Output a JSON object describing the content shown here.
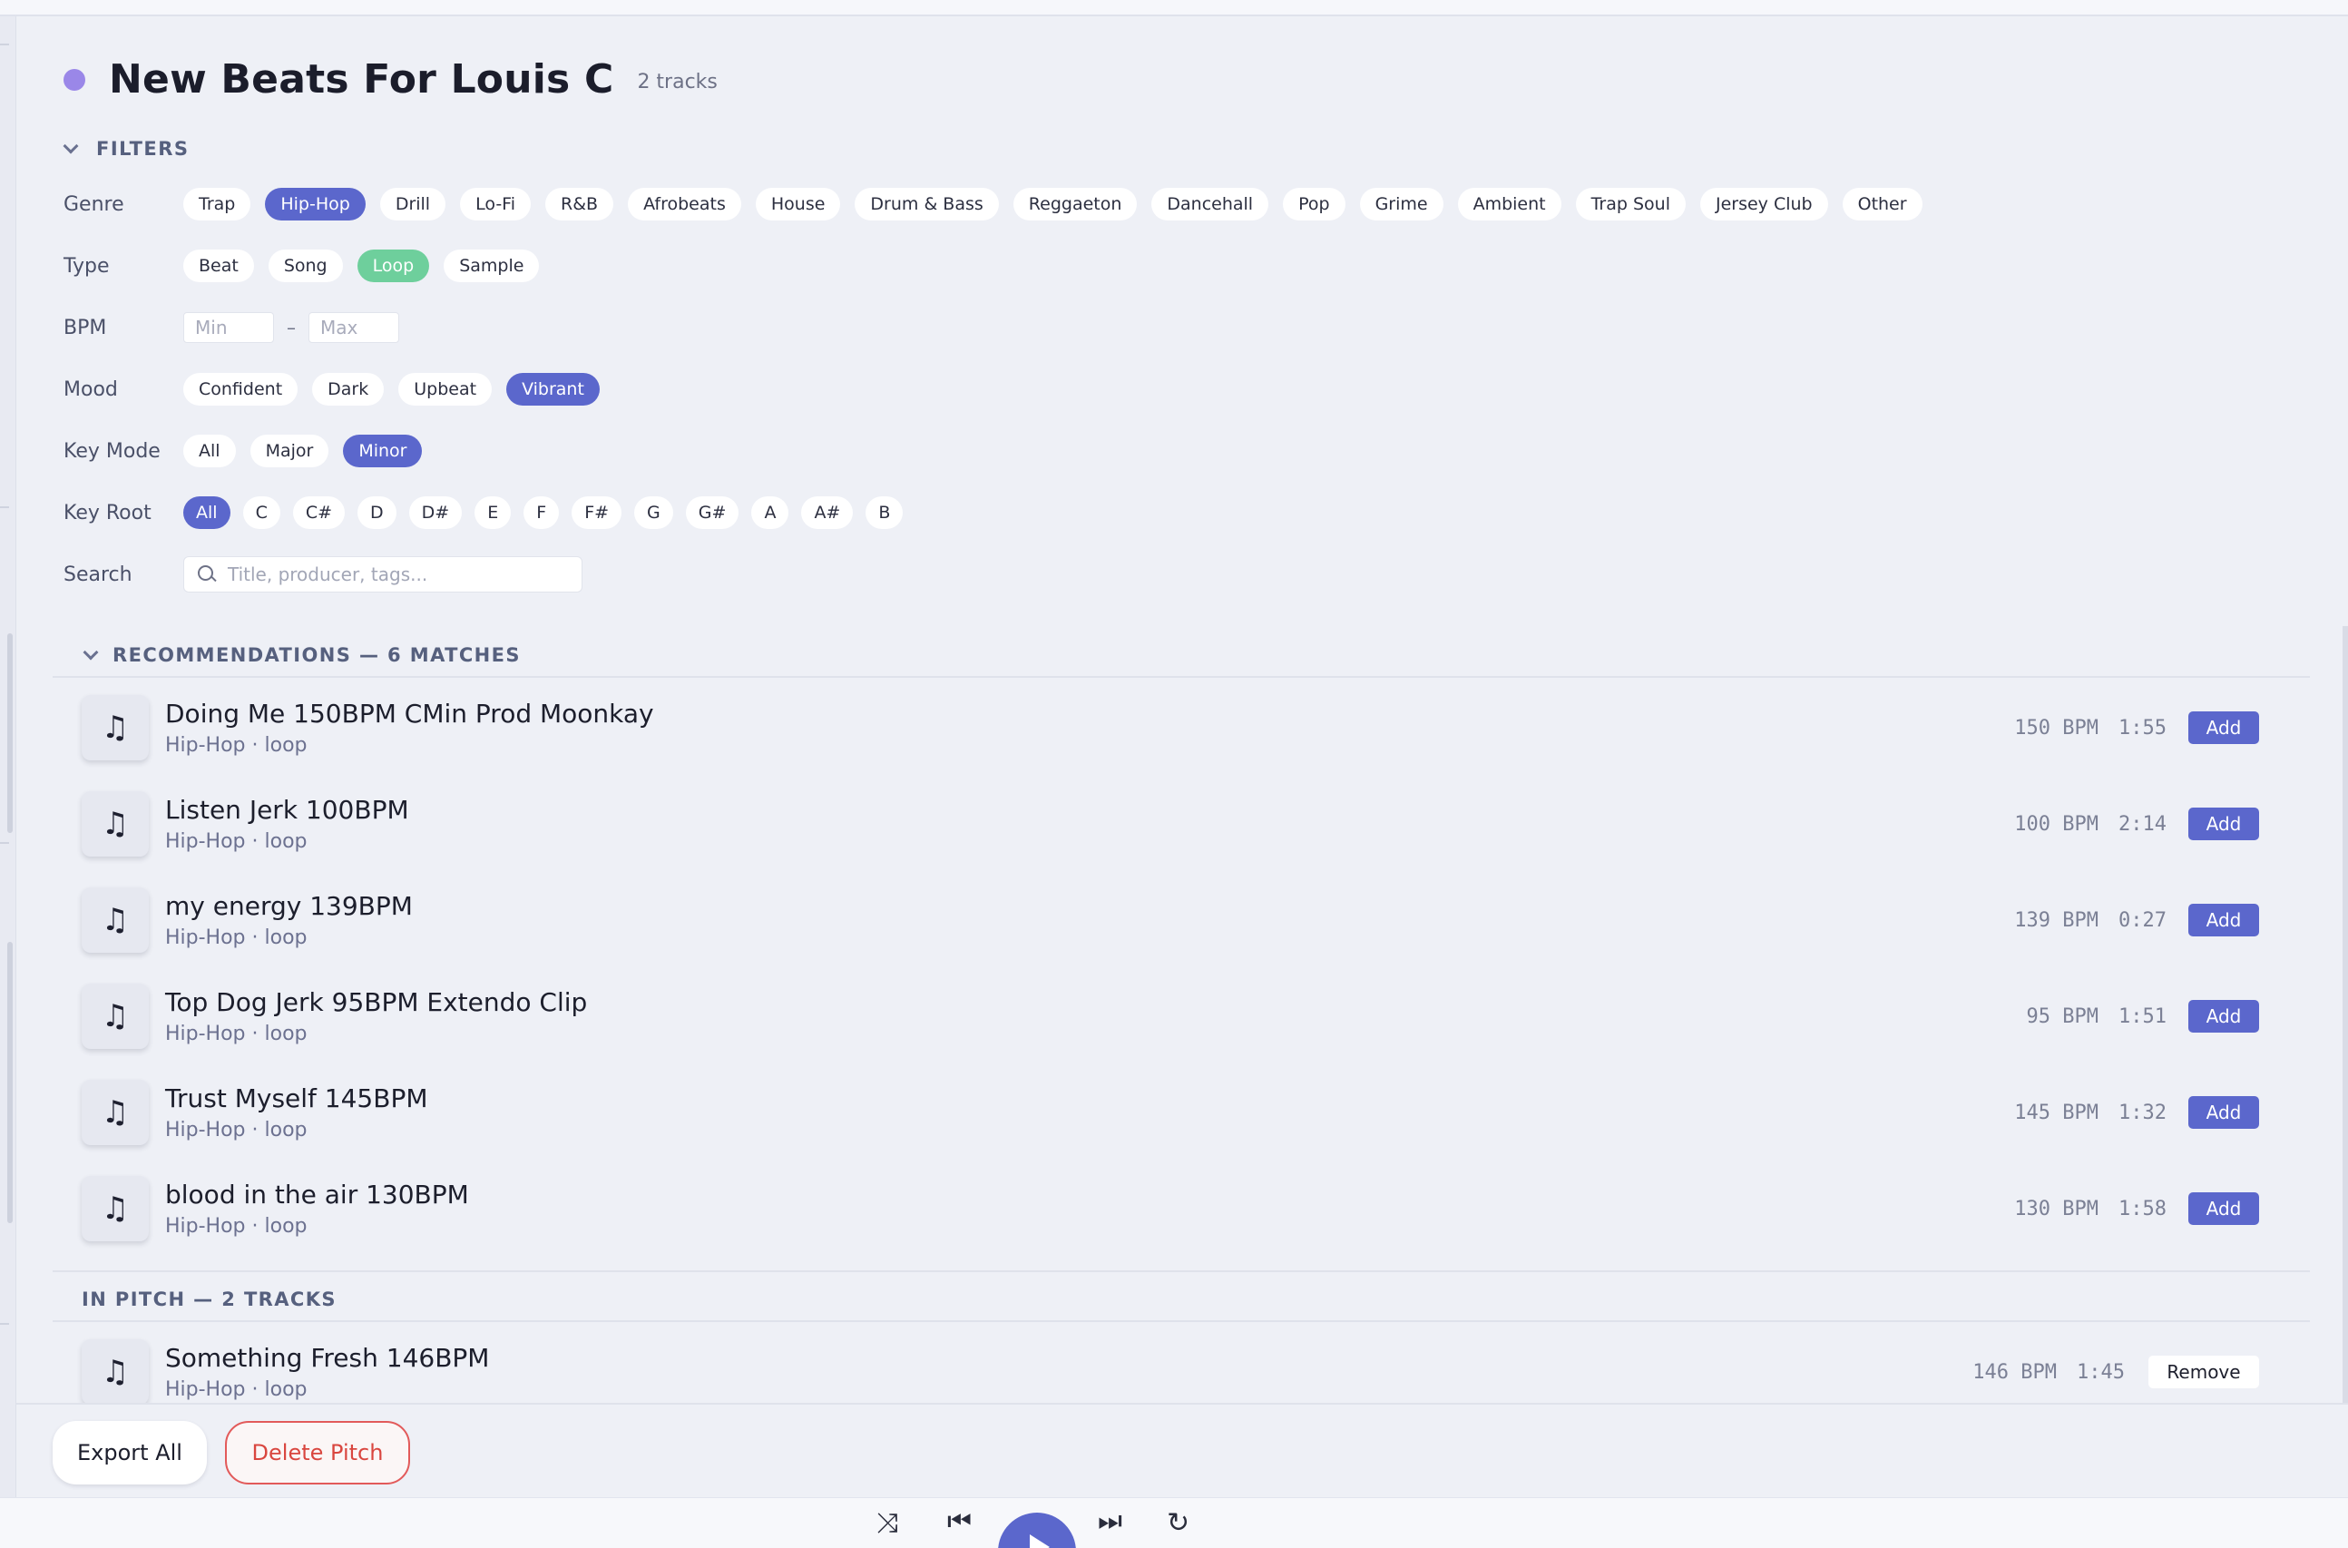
{
  "playlist": {
    "title": "New Beats For Louis C",
    "track_count": "2 tracks"
  },
  "filters": {
    "heading": "FILTERS",
    "genre": {
      "label": "Genre",
      "options": [
        "Trap",
        "Hip-Hop",
        "Drill",
        "Lo-Fi",
        "R&B",
        "Afrobeats",
        "House",
        "Drum & Bass",
        "Reggaeton",
        "Dancehall",
        "Pop",
        "Grime",
        "Ambient",
        "Trap Soul",
        "Jersey Club",
        "Other"
      ],
      "selected": "Hip-Hop"
    },
    "type": {
      "label": "Type",
      "options": [
        "Beat",
        "Song",
        "Loop",
        "Sample"
      ],
      "selected": "Loop"
    },
    "bpm": {
      "label": "BPM",
      "min_placeholder": "Min",
      "max_placeholder": "Max",
      "separator": "–"
    },
    "mood": {
      "label": "Mood",
      "options": [
        "Confident",
        "Dark",
        "Upbeat",
        "Vibrant"
      ],
      "selected": "Vibrant"
    },
    "key_mode": {
      "label": "Key Mode",
      "options": [
        "All",
        "Major",
        "Minor"
      ],
      "selected": "Minor"
    },
    "key_root": {
      "label": "Key Root",
      "options": [
        "All",
        "C",
        "C#",
        "D",
        "D#",
        "E",
        "F",
        "F#",
        "G",
        "G#",
        "A",
        "A#",
        "B"
      ],
      "selected": "All"
    },
    "search": {
      "label": "Search",
      "placeholder": "Title, producer, tags..."
    }
  },
  "recommendations": {
    "heading": "RECOMMENDATIONS — 6 MATCHES",
    "add_label": "Add",
    "tracks": [
      {
        "name": "Doing Me 150BPM CMin Prod Moonkay",
        "meta": "Hip-Hop · loop",
        "bpm": "150 BPM",
        "duration": "1:55"
      },
      {
        "name": "Listen Jerk 100BPM",
        "meta": "Hip-Hop · loop",
        "bpm": "100 BPM",
        "duration": "2:14"
      },
      {
        "name": "my energy 139BPM",
        "meta": "Hip-Hop · loop",
        "bpm": "139 BPM",
        "duration": "0:27"
      },
      {
        "name": "Top Dog Jerk 95BPM Extendo Clip",
        "meta": "Hip-Hop · loop",
        "bpm": "95 BPM",
        "duration": "1:51"
      },
      {
        "name": "Trust Myself 145BPM",
        "meta": "Hip-Hop · loop",
        "bpm": "145 BPM",
        "duration": "1:32"
      },
      {
        "name": "blood in the air 130BPM",
        "meta": "Hip-Hop · loop",
        "bpm": "130 BPM",
        "duration": "1:58"
      }
    ]
  },
  "in_pitch": {
    "heading": "IN PITCH — 2 TRACKS",
    "remove_label": "Remove",
    "tracks": [
      {
        "name": "Something Fresh 146BPM",
        "meta": "Hip-Hop · loop",
        "bpm": "146 BPM",
        "duration": "1:45"
      }
    ]
  },
  "actions": {
    "export_label": "Export All",
    "delete_label": "Delete Pitch"
  },
  "icons": {
    "track_art": "music-note-icon",
    "music_glyph": "♫"
  },
  "colors": {
    "accent": "#5b67cc",
    "loop_green": "#6ecf9c",
    "danger": "#d9463f",
    "playlist_dot": "#9a87e8"
  }
}
